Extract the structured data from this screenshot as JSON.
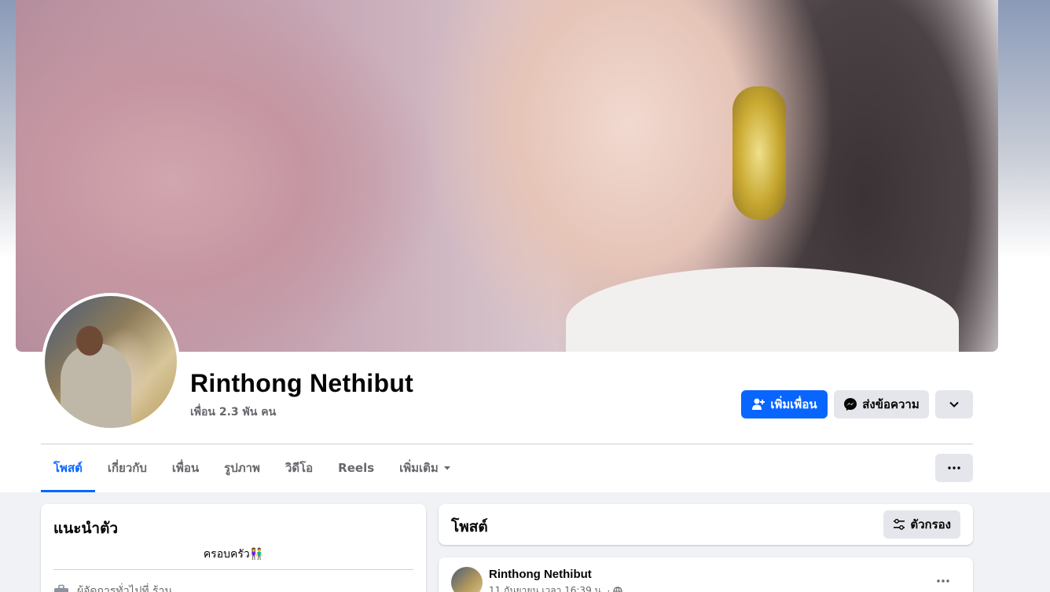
{
  "profile": {
    "name": "Rinthong Nethibut",
    "friends": "เพื่อน 2.3 พัน คน"
  },
  "actions": {
    "add_friend": "เพิ่มเพื่อน",
    "message": "ส่งข้อความ"
  },
  "tabs": [
    {
      "label": "โพสต์",
      "active": true
    },
    {
      "label": "เกี่ยวกับ"
    },
    {
      "label": "เพื่อน"
    },
    {
      "label": "รูปภาพ"
    },
    {
      "label": "วิดีโอ"
    },
    {
      "label": "Reels"
    },
    {
      "label": "เพิ่มเติม"
    }
  ],
  "intro": {
    "title": "แนะนำตัว",
    "bio": "ครอบครัว👫",
    "work": "ผู้จัดการทั่วไปที่ ร้าน..."
  },
  "posts": {
    "title": "โพสต์",
    "filter": "ตัวกรอง"
  },
  "post": {
    "author": "Rinthong Nethibut",
    "time": "11 กันยายน เวลา 16:39 น."
  },
  "colors": {
    "accent": "#0866ff",
    "secondary_button": "#e4e6eb",
    "muted_text": "#65676b"
  }
}
